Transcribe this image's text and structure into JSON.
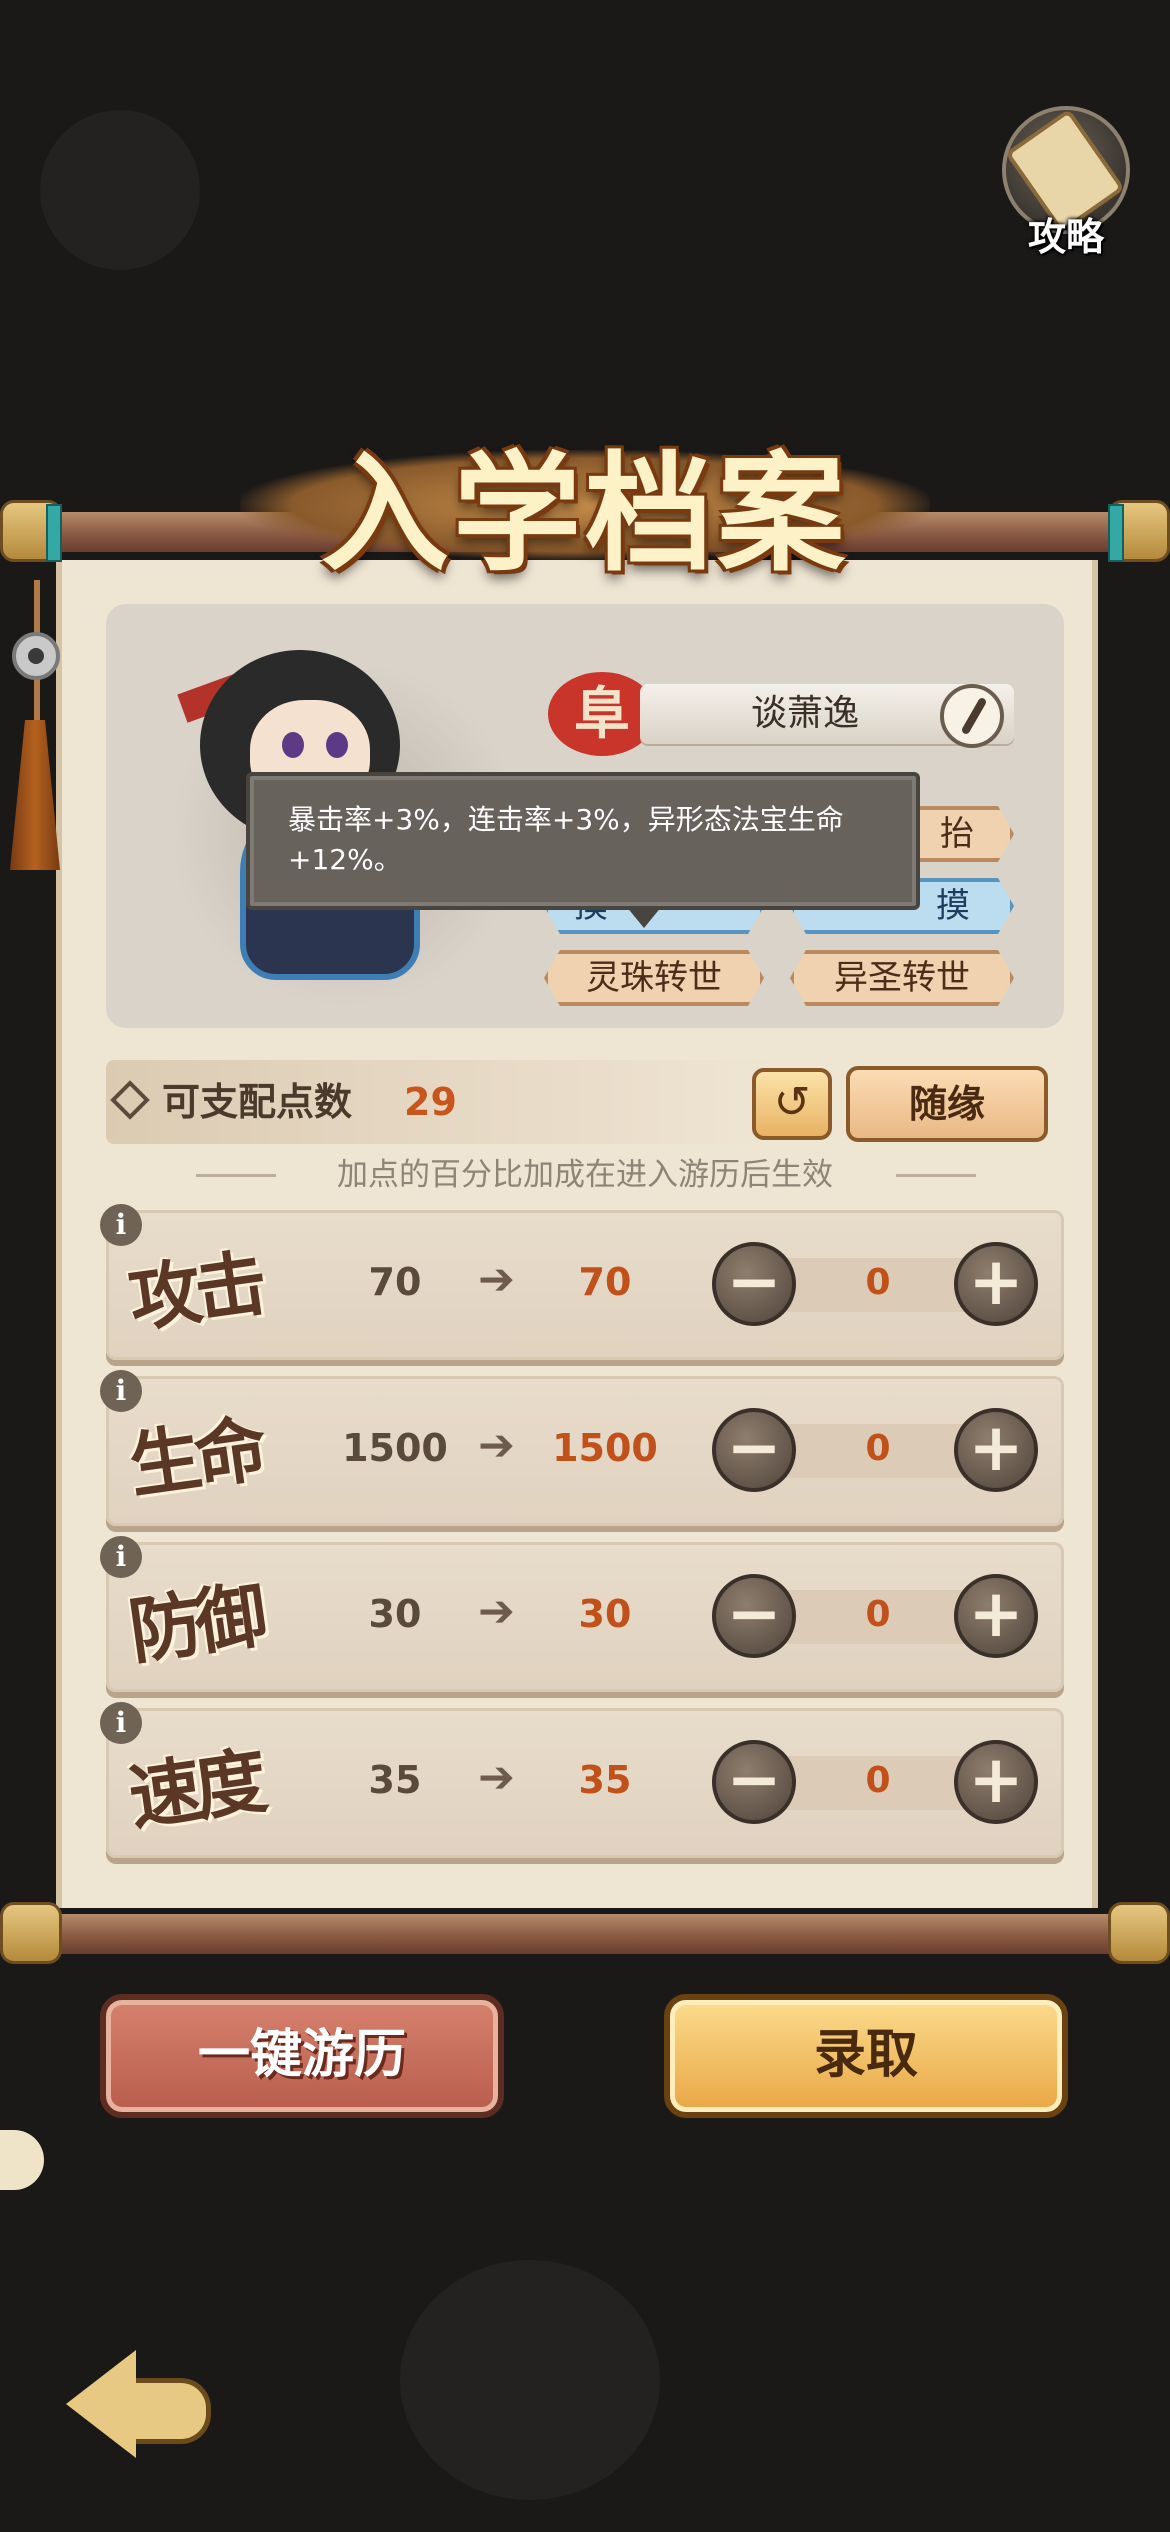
{
  "guide": {
    "label": "攻略"
  },
  "title": "入学档案",
  "character": {
    "seal": "阜",
    "name": "谈萧逸",
    "tags": [
      {
        "label": "抬",
        "style": "brown"
      },
      {
        "label": "摸",
        "style": "blue"
      },
      {
        "label": "摸",
        "style": "blue"
      },
      {
        "label": "灵珠转世",
        "style": "brown"
      },
      {
        "label": "异圣转世",
        "style": "brown"
      }
    ],
    "tooltip": "暴击率+3%，连击率+3%，异形态法宝生命+12%。"
  },
  "points": {
    "label": "可支配点数",
    "value": "29",
    "undo_icon": "↺",
    "random_label": "随缘"
  },
  "hint": "加点的百分比加成在进入游历后生效",
  "stats": [
    {
      "name": "攻击",
      "current": "70",
      "new": "70",
      "alloc": "0"
    },
    {
      "name": "生命",
      "current": "1500",
      "new": "1500",
      "alloc": "0"
    },
    {
      "name": "防御",
      "current": "30",
      "new": "30",
      "alloc": "0"
    },
    {
      "name": "速度",
      "current": "35",
      "new": "35",
      "alloc": "0"
    }
  ],
  "stat_glyphs": {
    "info": "i",
    "arrow": "➔",
    "minus": "−",
    "plus": "+"
  },
  "actions": {
    "left": "一键游历",
    "right": "录取"
  }
}
